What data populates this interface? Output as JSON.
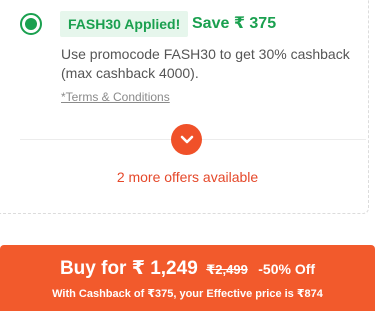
{
  "offer": {
    "applied_label": "FASH30 Applied!",
    "save_text": "Save ₹ 375",
    "description": "Use promocode FASH30 to get 30% cashback (max cashback 4000).",
    "terms_link": "*Terms & Conditions",
    "more_offers": "2 more offers available"
  },
  "buy": {
    "main_label": "Buy for ₹ 1,249",
    "mrp": "₹2,499",
    "discount": "-50% Off",
    "cashback_note": "With Cashback of ₹375, your Effective price is ₹874"
  },
  "colors": {
    "green": "#1aa04f",
    "accent": "#f25a2c",
    "badge_bg": "#e6f6ec"
  },
  "icons": {
    "radio": "radio-selected-icon",
    "expand": "chevron-down-icon"
  }
}
